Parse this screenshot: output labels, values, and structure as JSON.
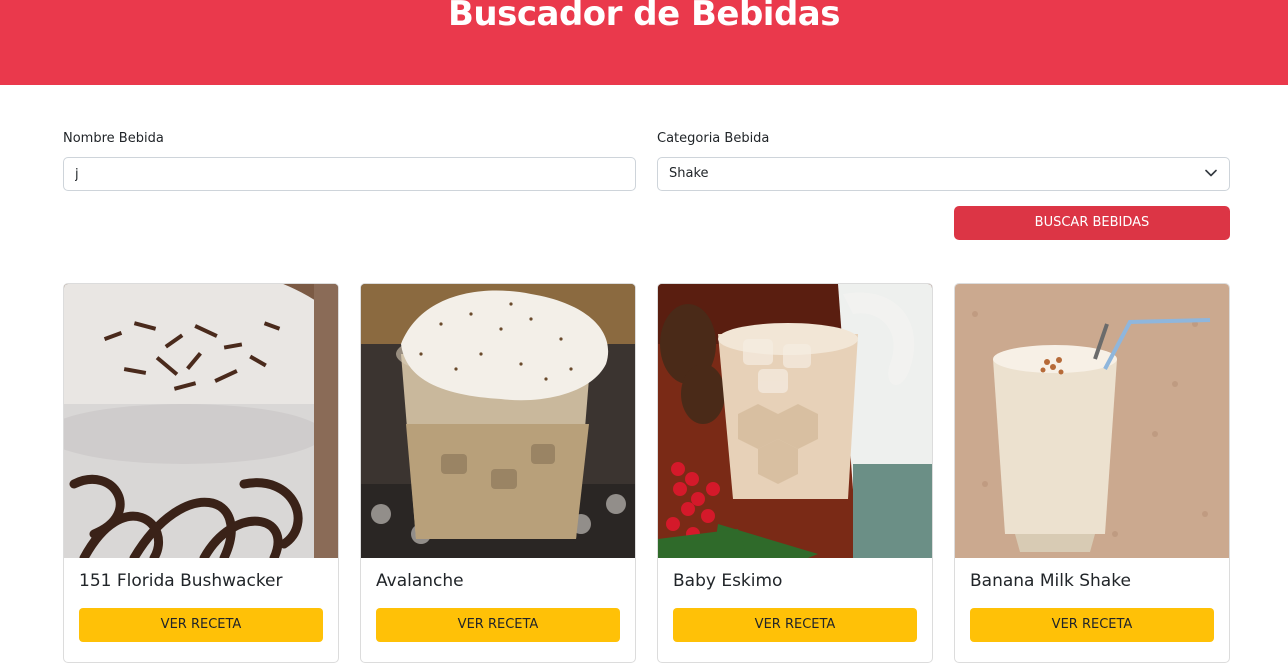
{
  "header": {
    "title": "Buscador de Bebidas"
  },
  "form": {
    "name_label": "Nombre Bebida",
    "name_value": "j",
    "category_label": "Categoria Bebida",
    "category_value": "Shake",
    "search_button": "Buscar Bebidas"
  },
  "colors": {
    "header_bg": "#ea394c",
    "search_button_bg": "#dc3545",
    "recipe_button_bg": "#ffc107"
  },
  "drinks": [
    {
      "name": "151 Florida Bushwacker",
      "button": "Ver Receta"
    },
    {
      "name": "Avalanche",
      "button": "Ver Receta"
    },
    {
      "name": "Baby Eskimo",
      "button": "Ver Receta"
    },
    {
      "name": "Banana Milk Shake",
      "button": "Ver Receta"
    }
  ]
}
